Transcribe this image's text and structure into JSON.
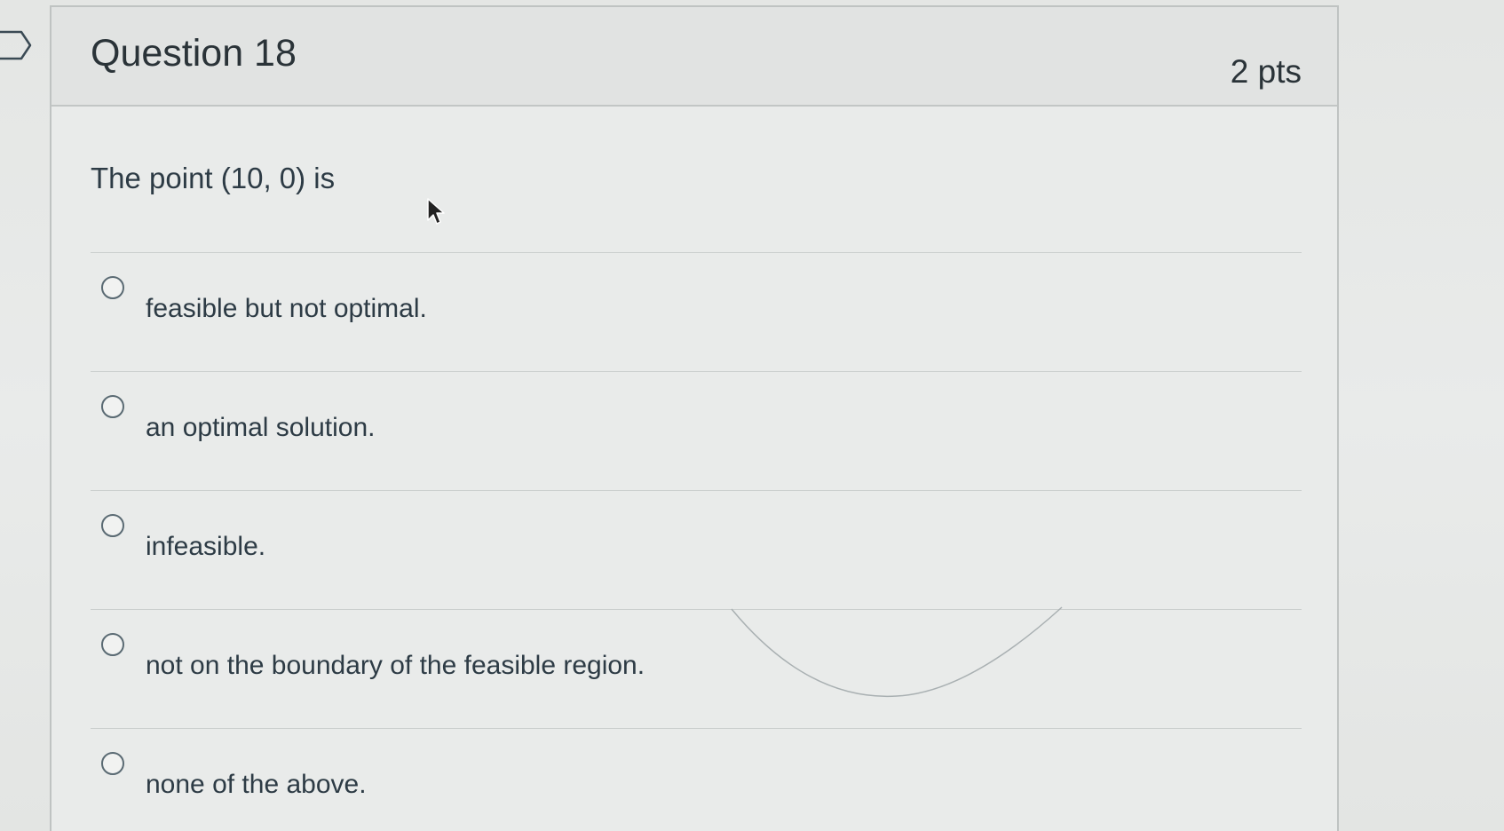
{
  "question": {
    "title": "Question 18",
    "points": "2 pts",
    "text": "The point (10, 0) is"
  },
  "answers": [
    {
      "label": "feasible but not optimal.",
      "selected": false
    },
    {
      "label": "an optimal solution.",
      "selected": false
    },
    {
      "label": "infeasible.",
      "selected": false
    },
    {
      "label": "not on the boundary of the feasible region.",
      "selected": false
    },
    {
      "label": "none of the above.",
      "selected": false
    }
  ],
  "icons": {
    "flag": "flag-icon",
    "cursor": "mouse-pointer-icon",
    "radio": "radio-button-icon"
  },
  "colors": {
    "text": "#2d3b45",
    "border": "#bfc3c2",
    "header_bg": "#e1e3e2",
    "radio_border": "#5a6a73"
  }
}
